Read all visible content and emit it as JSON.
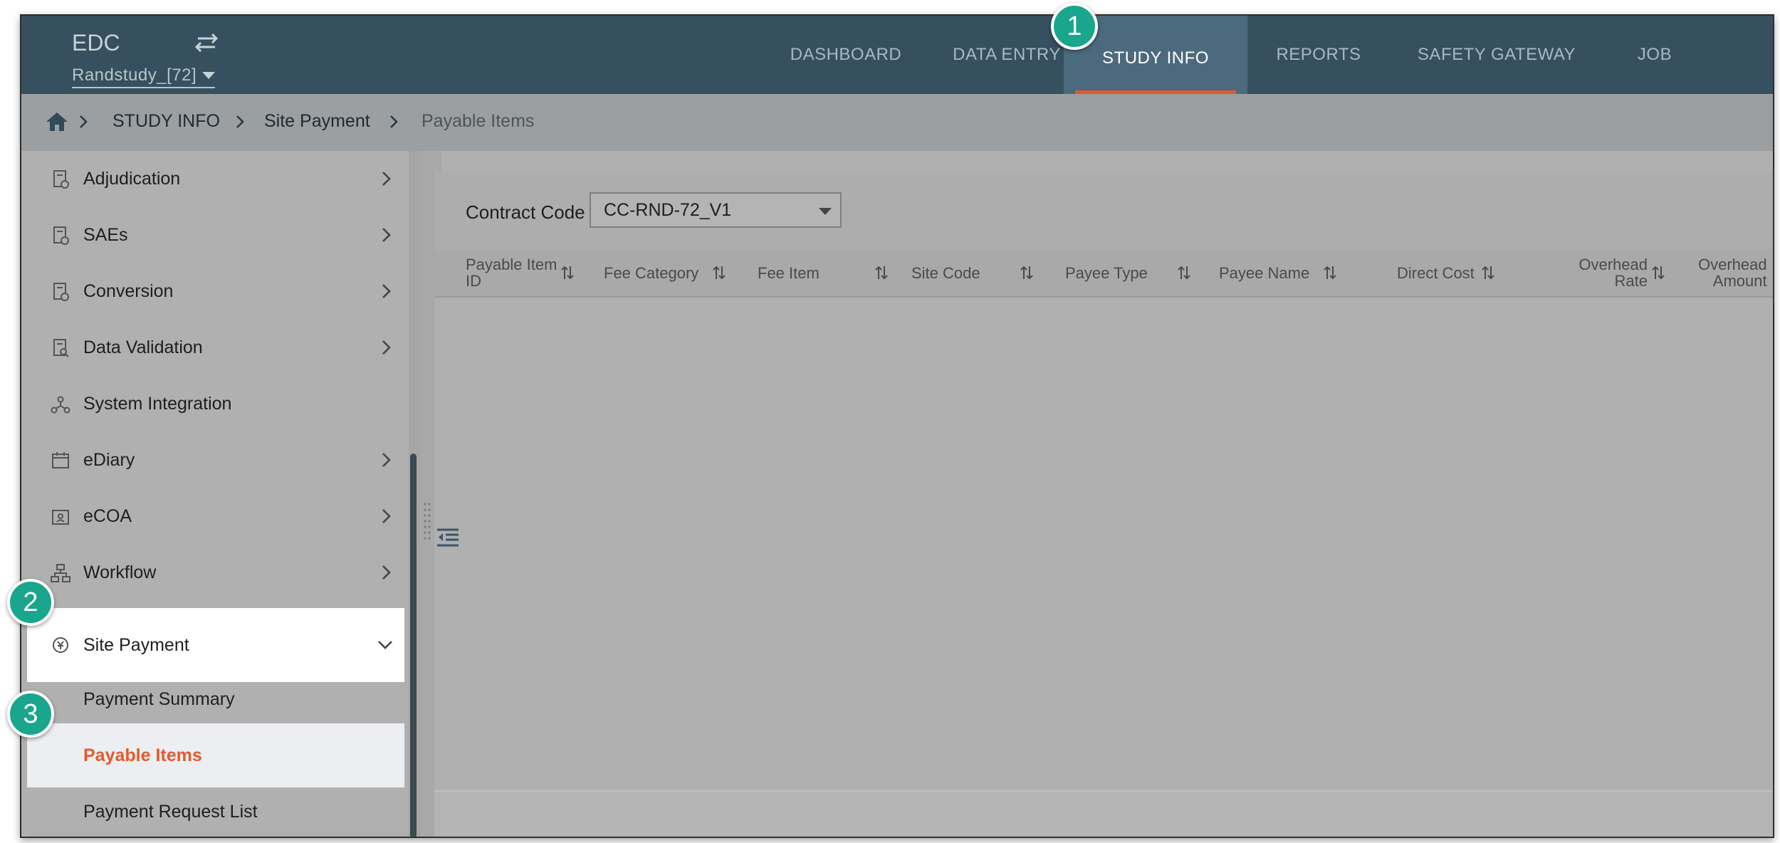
{
  "app": {
    "title": "EDC",
    "study": "Randstudy_[72]"
  },
  "nav": {
    "tabs": [
      {
        "label": "DASHBOARD"
      },
      {
        "label": "DATA ENTRY"
      },
      {
        "label": "STUDY INFO",
        "active": true
      },
      {
        "label": "REPORTS"
      },
      {
        "label": "SAFETY GATEWAY"
      },
      {
        "label": "JOB"
      }
    ]
  },
  "breadcrumb": [
    "STUDY INFO",
    "Site Payment",
    "Payable Items"
  ],
  "sidebar": {
    "items": [
      {
        "label": "Adjudication",
        "icon": "document-settings-icon",
        "expandable": true
      },
      {
        "label": "SAEs",
        "icon": "document-settings-icon",
        "expandable": true
      },
      {
        "label": "Conversion",
        "icon": "document-settings-icon",
        "expandable": true
      },
      {
        "label": "Data Validation",
        "icon": "document-search-icon",
        "expandable": true
      },
      {
        "label": "System Integration",
        "icon": "network-icon",
        "expandable": false
      },
      {
        "label": "eDiary",
        "icon": "calendar-icon",
        "expandable": true
      },
      {
        "label": "eCOA",
        "icon": "badge-icon",
        "expandable": true
      },
      {
        "label": "Workflow",
        "icon": "workflow-icon",
        "expandable": true
      },
      {
        "label": "Site Payment",
        "icon": "payment-icon",
        "expanded": true
      }
    ],
    "sub_items": [
      "Payment Summary",
      "Payable Items",
      "Payment Request List"
    ],
    "selected": "Payable Items"
  },
  "filter": {
    "label": "Contract Code",
    "value": "CC-RND-72_V1"
  },
  "table": {
    "columns": [
      "Payable Item\nID",
      "Fee Category",
      "Fee Item",
      "Site Code",
      "Payee Type",
      "Payee Name",
      "Direct Cost",
      "Overhead\nRate",
      "Overhead\nAmount"
    ]
  },
  "callouts": [
    "1",
    "2",
    "3"
  ],
  "colors": {
    "nav_bg": "#37505f",
    "accent": "#e55a2b",
    "callout": "#1aa58d"
  }
}
